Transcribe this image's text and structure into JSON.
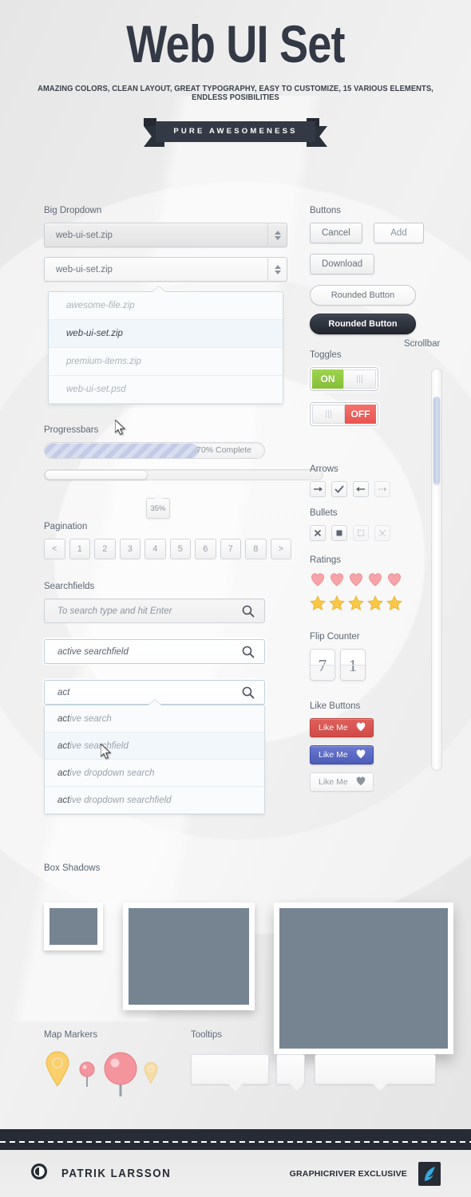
{
  "header": {
    "title": "Web UI Set",
    "subtitle": "AMAZING COLORS, CLEAN LAYOUT, GREAT TYPOGRAPHY, EASY TO CUSTOMIZE, 15 VARIOUS ELEMENTS, ENDLESS POSIBILITIES",
    "ribbon": "PURE AWESOMENESS"
  },
  "dropdown": {
    "label": "Big Dropdown",
    "select_1_value": "web-ui-set.zip",
    "select_2_value": "web-ui-set.zip",
    "options": [
      {
        "label": "awesome-file.zip",
        "active": false
      },
      {
        "label": "web-ui-set.zip",
        "active": true
      },
      {
        "label": "premium-items.zip",
        "active": false
      },
      {
        "label": "web-ui-set.psd",
        "active": false
      }
    ]
  },
  "buttons": {
    "label": "Buttons",
    "cancel": "Cancel",
    "add": "Add",
    "download": "Download",
    "rounded_light": "Rounded Button",
    "rounded_dark": "Rounded Button"
  },
  "toggles": {
    "label": "Toggles",
    "on_label": "ON",
    "off_label": "OFF",
    "on_color": "#8fc93f",
    "off_color": "#e9534f"
  },
  "scrollbar": {
    "label": "Scrollbar",
    "thumb_color": "#c3cde6"
  },
  "progressbars": {
    "label": "Progressbars",
    "bar1_text": "70% Complete",
    "bar1_percent": 70,
    "bar2_percent": 35,
    "bar2_badge": "35%"
  },
  "pagination": {
    "label": "Pagination",
    "items": [
      "<",
      "1",
      "2",
      "3",
      "4",
      "5",
      "6",
      "7",
      "8",
      ">"
    ]
  },
  "searchfields": {
    "label": "Searchfields",
    "field1_placeholder": "To search type and hit Enter",
    "field2_value": "active searchfield",
    "field3_value": "act",
    "suggestions": [
      {
        "match": "act",
        "rest": "ive search",
        "highlight": false
      },
      {
        "match": "act",
        "rest": "ive searchfield",
        "highlight": true
      },
      {
        "match": "act",
        "rest": "ive dropdown search",
        "highlight": false
      },
      {
        "match": "act",
        "rest": "ive dropdown searchfield",
        "highlight": false
      }
    ]
  },
  "arrows": {
    "label": "Arrows",
    "items": [
      "arrow-right-icon",
      "checkmark-icon",
      "arrow-left-icon",
      "arrow-right-dashed-icon"
    ]
  },
  "bullets": {
    "label": "Bullets",
    "items": [
      "x-mark-icon",
      "filled-square-icon",
      "dotted-square-icon",
      "dotted-x-icon"
    ]
  },
  "ratings": {
    "label": "Ratings",
    "hearts": 5,
    "stars": 5,
    "heart_color": "#f49a9f",
    "star_color": "#fbc02d"
  },
  "flip_counter": {
    "label": "Flip Counter",
    "digits": [
      "7",
      "1"
    ]
  },
  "like_buttons": {
    "label": "Like Buttons",
    "items": [
      {
        "text": "Like Me",
        "style": "red",
        "color": "#d14b47"
      },
      {
        "text": "Like Me",
        "style": "blue",
        "color": "#4c5cb8"
      },
      {
        "text": "Like Me",
        "style": "white",
        "color": "#f4f4f4"
      }
    ]
  },
  "box_shadows": {
    "label": "Box Shadows",
    "fill_color": "#768492"
  },
  "map_markers": {
    "label": "Map Markers"
  },
  "tooltips": {
    "label": "Tooltips"
  },
  "footer": {
    "author": "PATRIK LARSSON",
    "exclusive": "GRAPHICRIVER EXCLUSIVE"
  }
}
